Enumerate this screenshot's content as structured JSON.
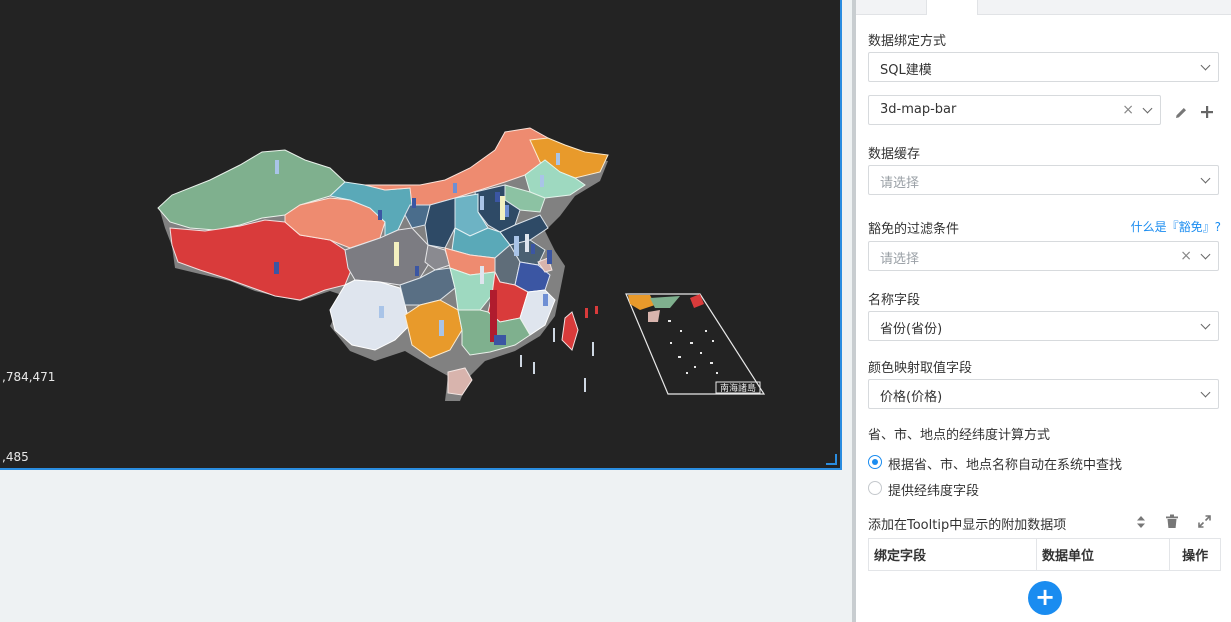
{
  "canvas": {
    "background": "#232323",
    "legend": {
      "max_label": ",784,471",
      "min_label": ",485"
    },
    "inset_label": "南海諸島"
  },
  "panel": {
    "tabs": [
      {
        "label": ""
      },
      {
        "label": ""
      },
      {
        "label": ""
      }
    ],
    "binding_method": {
      "label": "数据绑定方式",
      "value": "SQL建模"
    },
    "dataset": {
      "value": "3d-map-bar"
    },
    "cache": {
      "label": "数据缓存",
      "placeholder": "请选择"
    },
    "exempt_filter": {
      "label": "豁免的过滤条件",
      "help_link": "什么是『豁免』?",
      "placeholder": "请选择"
    },
    "name_field": {
      "label": "名称字段",
      "value": "省份(省份)"
    },
    "color_field": {
      "label": "颜色映射取值字段",
      "value": "价格(价格)"
    },
    "geo_method": {
      "label": "省、市、地点的经纬度计算方式",
      "options": [
        {
          "label": "根据省、市、地点名称自动在系统中查找",
          "checked": true
        },
        {
          "label": "提供经纬度字段",
          "checked": false
        }
      ]
    },
    "tooltip": {
      "label": "添加在Tooltip中显示的附加数据项",
      "columns": [
        "绑定字段",
        "数据单位",
        "操作"
      ]
    }
  },
  "colors": {
    "accent": "#1a8cf0",
    "canvas_border": "#2a8de0"
  }
}
